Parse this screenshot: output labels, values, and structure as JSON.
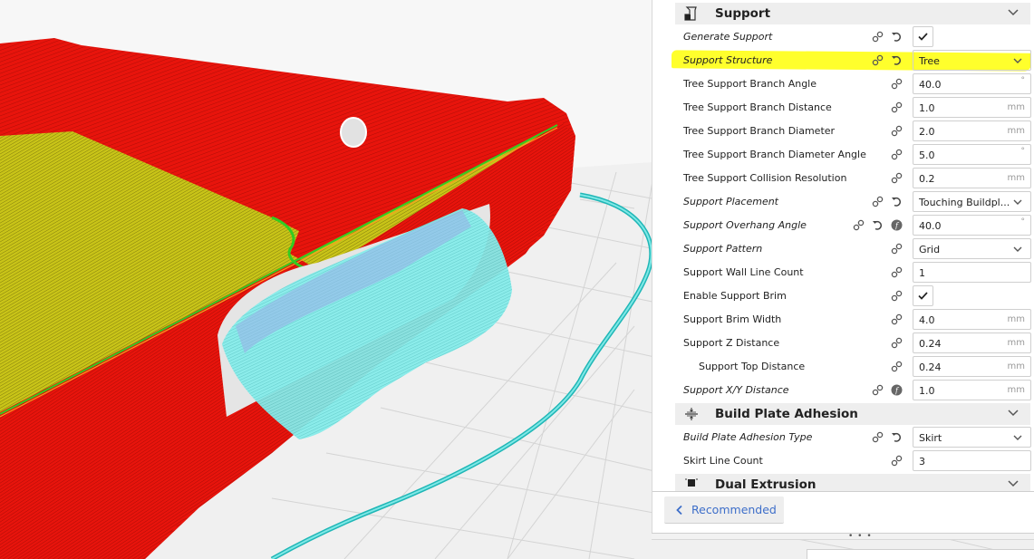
{
  "viewport": {
    "description": "3D layer view of sliced phone case with tree support",
    "colors": {
      "background": "#f7f7f7",
      "build_plate_grid": "#d4d4d4",
      "wall": "#e8140c",
      "wall_dark": "#b30d07",
      "top_skin": "#c9c418",
      "inner_wall": "#33cc22",
      "support": "#7ee8e6",
      "support_dark": "#2bb8b8",
      "support_interface": "#9aaee8",
      "skirt": "#22c8c8"
    }
  },
  "settings": {
    "support_section": {
      "title": "Support",
      "icon": "support-icon",
      "rows": [
        {
          "label": "Generate Support",
          "italic": true,
          "type": "checkbox",
          "checked": true,
          "icons": [
            "link-icon",
            "reset-icon"
          ]
        },
        {
          "label": "Support Structure",
          "italic": true,
          "type": "dropdown",
          "value": "Tree",
          "icons": [
            "link-icon",
            "reset-icon"
          ],
          "highlighted": true
        },
        {
          "label": "Tree Support Branch Angle",
          "italic": false,
          "type": "number",
          "value": "40.0",
          "unit": "°",
          "icons": [
            "link-icon"
          ]
        },
        {
          "label": "Tree Support Branch Distance",
          "italic": false,
          "type": "number",
          "value": "1.0",
          "unit": "mm",
          "icons": [
            "link-icon"
          ]
        },
        {
          "label": "Tree Support Branch Diameter",
          "italic": false,
          "type": "number",
          "value": "2.0",
          "unit": "mm",
          "icons": [
            "link-icon"
          ]
        },
        {
          "label": "Tree Support Branch Diameter Angle",
          "italic": false,
          "type": "number",
          "value": "5.0",
          "unit": "°",
          "icons": [
            "link-icon"
          ]
        },
        {
          "label": "Tree Support Collision Resolution",
          "italic": false,
          "type": "number",
          "value": "0.2",
          "unit": "mm",
          "icons": [
            "link-icon"
          ]
        },
        {
          "label": "Support Placement",
          "italic": true,
          "type": "dropdown",
          "value": "Touching Buildpl...",
          "icons": [
            "link-icon",
            "reset-icon"
          ]
        },
        {
          "label": "Support Overhang Angle",
          "italic": true,
          "type": "number",
          "value": "40.0",
          "unit": "°",
          "icons": [
            "link-icon",
            "reset-icon",
            "function-icon"
          ]
        },
        {
          "label": "Support Pattern",
          "italic": true,
          "type": "dropdown",
          "value": "Grid",
          "icons": [
            "link-icon"
          ]
        },
        {
          "label": "Support Wall Line Count",
          "italic": false,
          "type": "number",
          "value": "1",
          "unit": "",
          "icons": [
            "link-icon"
          ]
        },
        {
          "label": "Enable Support Brim",
          "italic": false,
          "type": "checkbox",
          "checked": true,
          "icons": [
            "link-icon"
          ]
        },
        {
          "label": "Support Brim Width",
          "italic": false,
          "type": "number",
          "value": "4.0",
          "unit": "mm",
          "icons": [
            "link-icon"
          ]
        },
        {
          "label": "Support Z Distance",
          "italic": false,
          "type": "number",
          "value": "0.24",
          "unit": "mm",
          "icons": [
            "link-icon"
          ]
        },
        {
          "label": "Support Top Distance",
          "italic": false,
          "indent": true,
          "type": "number",
          "value": "0.24",
          "unit": "mm",
          "icons": [
            "link-icon"
          ]
        },
        {
          "label": "Support X/Y Distance",
          "italic": true,
          "type": "number",
          "value": "1.0",
          "unit": "mm",
          "icons": [
            "link-icon",
            "function-icon"
          ]
        }
      ]
    },
    "adhesion_section": {
      "title": "Build Plate Adhesion",
      "icon": "adhesion-icon",
      "rows": [
        {
          "label": "Build Plate Adhesion Type",
          "italic": true,
          "type": "dropdown",
          "value": "Skirt",
          "icons": [
            "link-icon",
            "reset-icon"
          ]
        },
        {
          "label": "Skirt Line Count",
          "italic": false,
          "type": "number",
          "value": "3",
          "unit": "",
          "icons": [
            "link-icon"
          ]
        }
      ]
    },
    "dual_extrusion_section": {
      "title": "Dual Extrusion",
      "icon": "dual-extrusion-icon"
    }
  },
  "footer": {
    "recommended_label": "Recommended"
  },
  "resize_handle": {
    "dots": "• • •"
  },
  "accent_colors": {
    "link_blue": "#3d6ec9",
    "highlight_yellow": "#ffff1a"
  }
}
